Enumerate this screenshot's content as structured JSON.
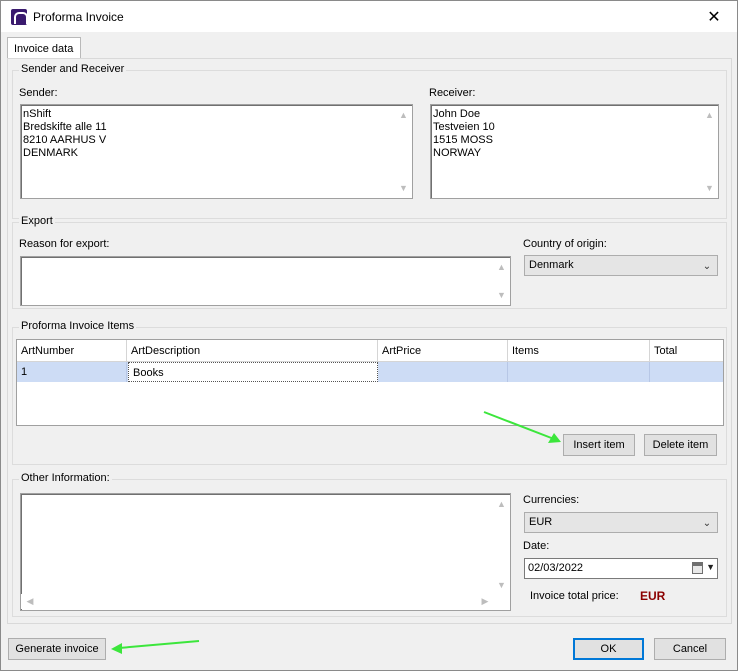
{
  "window": {
    "title": "Proforma Invoice",
    "close_glyph": "✕"
  },
  "tab": {
    "label": "Invoice data"
  },
  "sender_receiver": {
    "legend": "Sender and Receiver",
    "sender_label": "Sender:",
    "sender_text": "nShift\nBredskifte alle 11\n8210 AARHUS V\nDENMARK",
    "receiver_label": "Receiver:",
    "receiver_text": "John Doe\nTestveien 10\n1515 MOSS\nNORWAY"
  },
  "export": {
    "legend": "Export",
    "reason_label": "Reason for export:",
    "reason_value": "",
    "country_label": "Country of origin:",
    "country_value": "Denmark"
  },
  "items": {
    "legend": "Proforma Invoice Items",
    "columns": [
      "ArtNumber",
      "ArtDescription",
      "ArtPrice",
      "Items",
      "Total"
    ],
    "rows": [
      {
        "ArtNumber": "1",
        "ArtDescription": "Books",
        "ArtPrice": "",
        "Items": "",
        "Total": ""
      }
    ],
    "insert_label": "Insert item",
    "delete_label": "Delete item"
  },
  "other": {
    "legend": "Other Information:",
    "text": "",
    "currencies_label": "Currencies:",
    "currency_value": "EUR",
    "date_label": "Date:",
    "date_value": "02/03/2022",
    "total_price_label": "Invoice total price:",
    "total_price_value": "EUR"
  },
  "footer": {
    "generate_label": "Generate invoice",
    "ok_label": "OK",
    "cancel_label": "Cancel"
  },
  "colors": {
    "annotation_arrow": "#3ce63c",
    "total_price_value": "#8b0000",
    "selected_row": "#cddcf5",
    "ok_border": "#0078d7"
  },
  "icons": {
    "app": "nshift-logo-icon",
    "close": "close-icon",
    "dropdown": "chevron-down-icon",
    "calendar": "calendar-icon"
  }
}
